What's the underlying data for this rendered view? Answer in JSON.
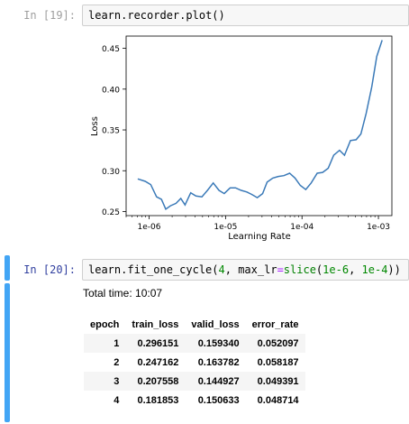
{
  "cell1": {
    "prompt": "In [19]:",
    "code": {
      "obj": "learn",
      "dot1": ".",
      "attr1": "recorder",
      "dot2": ".",
      "fn": "plot",
      "parens": "()"
    }
  },
  "cell2": {
    "prompt": "In [20]:",
    "code": {
      "obj": "learn",
      "dot": ".",
      "fn": "fit_one_cycle",
      "open": "(",
      "arg1": "4",
      "comma1": ", ",
      "kw": "max_lr",
      "eq": "=",
      "fn2": "slice",
      "open2": "(",
      "v1": "1e-6",
      "comma2": ", ",
      "v2": "1e-4",
      "close": "))"
    },
    "total_time": "Total time: 10:07",
    "table": {
      "headers": [
        "epoch",
        "train_loss",
        "valid_loss",
        "error_rate"
      ],
      "rows": [
        [
          "1",
          "0.296151",
          "0.159340",
          "0.052097"
        ],
        [
          "2",
          "0.247162",
          "0.163782",
          "0.058187"
        ],
        [
          "3",
          "0.207558",
          "0.144927",
          "0.049391"
        ],
        [
          "4",
          "0.181853",
          "0.150633",
          "0.048714"
        ]
      ]
    }
  },
  "chart_data": {
    "type": "line",
    "xlabel": "Learning Rate",
    "ylabel": "Loss",
    "xscale": "log",
    "xlim": [
      5e-07,
      0.0015
    ],
    "ylim": [
      0.245,
      0.465
    ],
    "xticks": [
      1e-06,
      1e-05,
      0.0001,
      0.001
    ],
    "xtick_labels": [
      "1e-06",
      "1e-05",
      "1e-04",
      "1e-03"
    ],
    "yticks": [
      0.25,
      0.3,
      0.35,
      0.4,
      0.45
    ],
    "ytick_labels": [
      "0.25",
      "0.30",
      "0.35",
      "0.40",
      "0.45"
    ],
    "color": "#3b7ab8",
    "series": [
      {
        "x": [
          7.1e-07,
          8.9e-07,
          1.05e-06,
          1.25e-06,
          1.45e-06,
          1.65e-06,
          1.9e-06,
          2.25e-06,
          2.6e-06,
          2.95e-06,
          3.5e-06,
          4.1e-06,
          4.9e-06,
          5.8e-06,
          6.9e-06,
          8.2e-06,
          9.6e-06,
          1.15e-05,
          1.35e-05,
          1.6e-05,
          1.9e-05,
          2.2e-05,
          2.6e-05,
          3.05e-05,
          3.5e-05,
          4.15e-05,
          4.9e-05,
          5.8e-05,
          6.9e-05,
          8.1e-05,
          9.5e-05,
          0.000112,
          0.000132,
          0.000158,
          0.000186,
          0.00022,
          0.00026,
          0.00031,
          0.00036,
          0.00043,
          0.00051,
          0.00059,
          0.00069,
          0.00082,
          0.00095,
          0.00112
        ],
        "y": [
          0.29,
          0.287,
          0.283,
          0.268,
          0.265,
          0.253,
          0.257,
          0.26,
          0.266,
          0.258,
          0.273,
          0.269,
          0.268,
          0.276,
          0.285,
          0.276,
          0.272,
          0.279,
          0.279,
          0.276,
          0.274,
          0.271,
          0.267,
          0.272,
          0.286,
          0.291,
          0.293,
          0.294,
          0.297,
          0.291,
          0.282,
          0.277,
          0.285,
          0.297,
          0.298,
          0.303,
          0.319,
          0.325,
          0.319,
          0.337,
          0.338,
          0.345,
          0.37,
          0.403,
          0.44,
          0.46
        ]
      }
    ]
  }
}
